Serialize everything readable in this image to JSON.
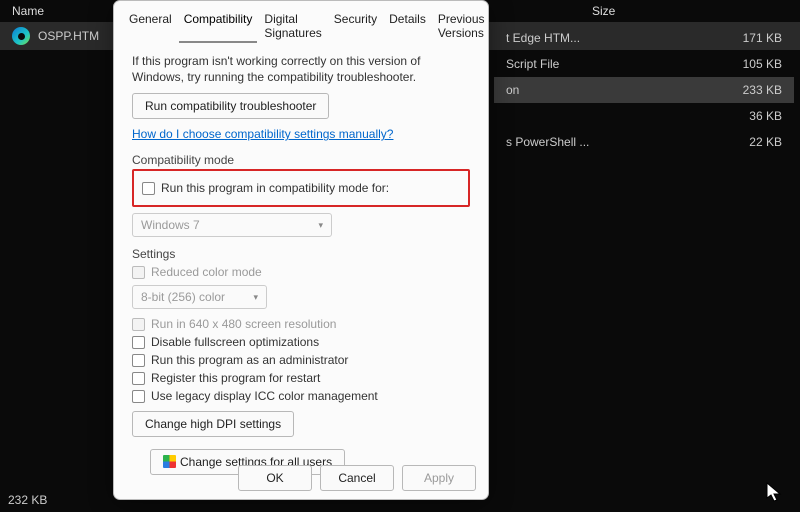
{
  "explorer": {
    "columns": {
      "name": "Name",
      "size": "Size"
    },
    "file_name": "OSPP.HTM",
    "status": "232 KB",
    "rows": [
      {
        "type": "t Edge HTM...",
        "size": "171 KB"
      },
      {
        "type": "Script File",
        "size": "105 KB"
      },
      {
        "type": "on",
        "size": "233 KB",
        "selected": true
      },
      {
        "type": "",
        "size": "36 KB"
      },
      {
        "type": "s PowerShell ...",
        "size": "22 KB"
      }
    ]
  },
  "dialog": {
    "tabs": [
      "General",
      "Compatibility",
      "Digital Signatures",
      "Security",
      "Details",
      "Previous Versions"
    ],
    "active_tab": 1,
    "help1": "If this program isn't working correctly on this version of Windows, try running the compatibility troubleshooter.",
    "btn_troubleshoot": "Run compatibility troubleshooter",
    "link": "How do I choose compatibility settings manually?",
    "compat_group": "Compatibility mode",
    "chk_compat": "Run this program in compatibility mode for:",
    "compat_select": "Windows 7",
    "settings_group": "Settings",
    "chk_reduced": "Reduced color mode",
    "color_select": "8-bit (256) color",
    "chk_640": "Run in 640 x 480 screen resolution",
    "chk_fullscreen": "Disable fullscreen optimizations",
    "chk_admin": "Run this program as an administrator",
    "chk_restart": "Register this program for restart",
    "chk_icc": "Use legacy display ICC color management",
    "btn_hdpi": "Change high DPI settings",
    "btn_allusers": "Change settings for all users",
    "btn_ok": "OK",
    "btn_cancel": "Cancel",
    "btn_apply": "Apply"
  }
}
